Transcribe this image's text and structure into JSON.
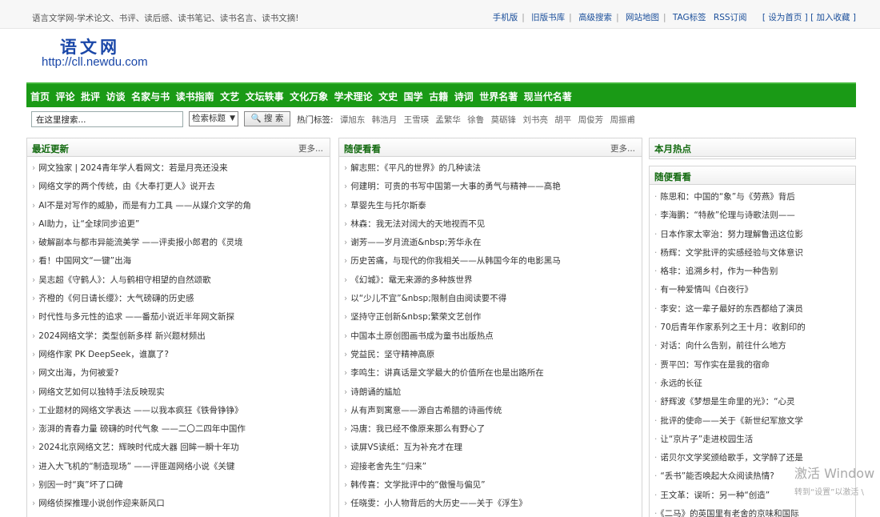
{
  "topbar": {
    "slogan": "语言文学网-学术论文、书评、读后感、读书笔记、读书名言、读书文摘!",
    "links": [
      "手机版",
      "旧版书库",
      "高级搜索",
      "网站地图",
      "TAG标签",
      "RSS订阅"
    ],
    "set_home": "[ 设为首页 ]",
    "add_fav": "[ 加入收藏 ]"
  },
  "logo": {
    "name": "语文网",
    "url": "http://cll.newdu.com"
  },
  "nav": {
    "items": [
      "首页",
      "评论",
      "批评",
      "访谈",
      "名家与书",
      "读书指南",
      "文艺",
      "文坛轶事",
      "文化万象",
      "学术理论",
      "文史",
      "国学",
      "古籍",
      "诗词",
      "世界名著",
      "现当代名著"
    ]
  },
  "search": {
    "placeholder": "在这里搜索...",
    "value": "在这里搜索...",
    "select_value": "检索标题",
    "button": "🔍 搜 索",
    "hot_label": "热门标签:",
    "hot_tags": [
      "谭旭东",
      "韩浩月",
      "王雪瑛",
      "孟繁华",
      "徐鲁",
      "莫砺锋",
      "刘书亮",
      "胡平",
      "周俊芳",
      "周振甫"
    ]
  },
  "left": {
    "title": "最近更新",
    "more": "更多...",
    "items": [
      "网文独家 | 2024青年学人看网文：若是月亮还没来",
      "网络文学的两个传统，由《大奉打更人》说开去",
      "AI不是对写作的威胁，而是有力工具 ——从媒介文学的角",
      "AI助力，让“全球同步追更”",
      "破解副本与都市异能流美学 ——评卖报小郎君的《灵境",
      "看！中国网文“一键”出海",
      "吴志超《守鹤人》：人与鹤相守相望的自然颂歌",
      "齐橙的《何日请长缨》：大气磅礴的历史感",
      "时代性与多元性的追求 ——番茄小说近半年网文新探",
      "2024网络文学：类型创新多样 新兴题材频出",
      "网络作家 PK DeepSeek，谁赢了?",
      "网文出海，为何被爱?",
      "网络文艺如何以独特手法反映现实",
      "工业题材的网络文学表达 ——以我本疯狂《铁骨铮铮》",
      "澎湃的青春力量 磅礴的时代气象 ——二〇二四年中国作",
      "2024北京网络文艺：辉映时代成大器 回眸一瞬十年功",
      "进入大飞机的“制造现场” ——评匪迦网络小说《关键",
      "别因一时“爽”坏了口碑",
      "网络侦探推理小说创作迎来新风口"
    ]
  },
  "middle": {
    "title": "随便看看",
    "more": "更多...",
    "items": [
      "解志熙：《平凡的世界》的几种读法",
      "何建明：可贵的书写中国第一大事的勇气与精神——高艳",
      "草婴先生与托尔斯泰",
      "林森：我无法对阔大的天地视而不见",
      "谢芳——岁月流逝&nbsp;芳华永在",
      "历史苦痛，与现代的你我相关——从韩国今年的电影黑马",
      "《幻城》：鼋无来源的多种族世界",
      "以“少儿不宜”&nbsp;限制自由阅读要不得",
      "坚持守正创新&nbsp;繁荣文艺创作",
      "中国本土原创图画书成为童书出版热点",
      "党益民：坚守精神高原",
      "李鸣生：讲真话是文学最大的价值所在也是出路所在",
      "诗朗诵的尴尬",
      "从有声到寓意——源自古希腊的诗画传统",
      "冯唐：我已经不像原来那么有野心了",
      "读屏VS读纸：互为补充才在理",
      "迎接老舍先生“归来”",
      "韩传喜：文学批评中的“傲慢与偏见”",
      "任晓雯：小人物背后的大历史——关于《浮生》"
    ]
  },
  "right": {
    "hot_title": "本月热点",
    "random_title": "随便看看",
    "items": [
      "陈思和：中国的“象”与《劳燕》背后",
      "李海鹏：“特赦”伦理与诗歌法则——",
      "日本作家太宰治：努力理解鲁迅这位影",
      "杨辉：文学批评的实感经验与文体意识",
      "格非：追溯乡村，作为一种告别",
      "有一种爱情叫《白夜行》",
      "李安：这一辈子最好的东西都给了演员",
      "70后青年作家系列之王十月：收割印的",
      "对话：向什么告别，前往什么地方",
      "贾平凹：写作实在是我的宿命",
      "永远的长征",
      "舒辉波《梦想是生命里的光》：“心灵",
      "批评的使命——关于《新世纪军旅文学",
      "让“京片子”走进校园生活",
      "诺贝尔文学奖颁给歌手，文学醉了还是",
      "“丢书”能否唤起大众阅读热情?",
      "王文革：误听：另一种“创造”",
      "《二马》的英国里有老舍的京味和国际"
    ]
  },
  "watermark": {
    "line1": "激活 Window",
    "line2": "转到“设置”以激活 \\"
  }
}
